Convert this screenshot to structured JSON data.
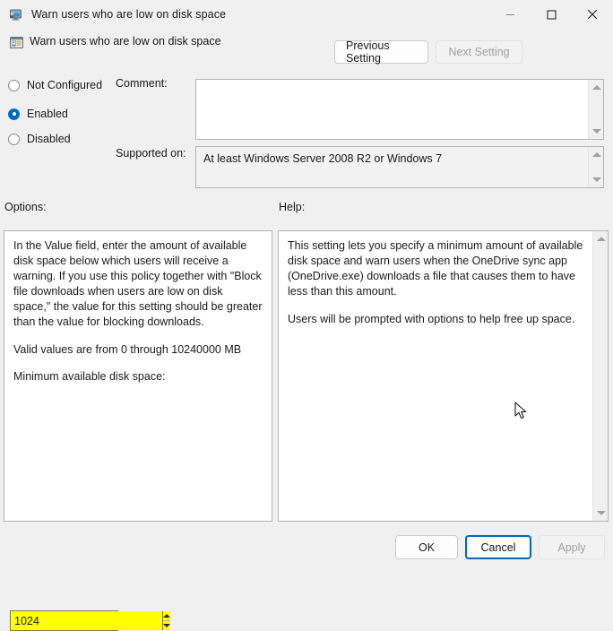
{
  "window": {
    "title": "Warn users who are low on disk space",
    "icon": "computer-monitor-icon",
    "controls": {
      "minimize": "minimize-icon",
      "maximize": "maximize-icon",
      "close": "close-icon"
    }
  },
  "header": {
    "icon": "policy-setting-icon",
    "title": "Warn users who are low on disk space",
    "previous_setting": "Previous Setting",
    "next_setting": "Next Setting",
    "next_setting_enabled": false
  },
  "state": {
    "options": [
      "Not Configured",
      "Enabled",
      "Disabled"
    ],
    "selected": "Enabled"
  },
  "comment": {
    "label": "Comment:",
    "value": "",
    "placeholder": ""
  },
  "supported": {
    "label": "Supported on:",
    "value": "At least Windows Server 2008 R2 or Windows 7"
  },
  "options_panel": {
    "label": "Options:",
    "paragraph1": "In the Value field, enter the amount of available disk space below which users will receive a warning. If you use this policy together with \"Block file downloads when users are low on disk space,\" the value for this setting should be greater than the value for blocking downloads.",
    "paragraph2": "Valid values are from 0 through 10240000 MB",
    "field_label": "Minimum available disk space:",
    "field_value": "1024",
    "field_highlight_color": "#ffff00",
    "spin_up": "spin-up-icon",
    "spin_down": "spin-down-icon"
  },
  "help_panel": {
    "label": "Help:",
    "paragraph1": "This setting lets you specify a minimum amount of available disk space and warn users when the OneDrive sync app (OneDrive.exe) downloads a file that causes them to have less than this amount.",
    "paragraph2": "Users will be prompted with options to help free up space."
  },
  "footer": {
    "ok": "OK",
    "cancel": "Cancel",
    "apply": "Apply",
    "apply_enabled": false,
    "focus_ring_color": "#0067c0"
  },
  "theme": {
    "window_background": "#f0f0f0",
    "panel_background": "#ffffff",
    "border": "#b4b4b4",
    "accent": "#0067c0",
    "text": "#1a1a1a",
    "disabled_text": "#a0a0a0"
  }
}
